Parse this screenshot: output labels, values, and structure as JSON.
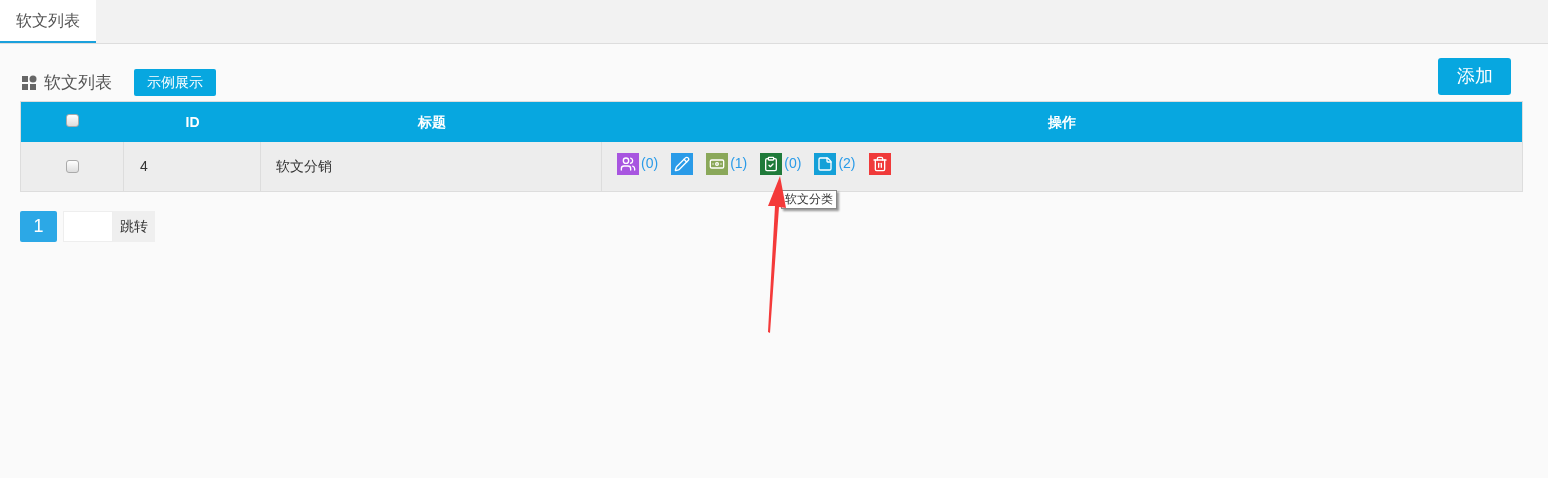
{
  "tabs": [
    {
      "label": "软文列表",
      "selected": true
    }
  ],
  "panel": {
    "title": "软文列表",
    "demo_button": "示例展示",
    "add_button": "添加"
  },
  "table": {
    "columns": [
      "ID",
      "标题",
      "操作"
    ],
    "header_checked": false,
    "rows": [
      {
        "checked": false,
        "id": "4",
        "title": "软文分销",
        "actions": [
          {
            "kind": "users",
            "color": "#a855e0",
            "count": "(0)"
          },
          {
            "kind": "edit",
            "color": "#2a9be8"
          },
          {
            "kind": "money",
            "color": "#8aa85a",
            "count": "(1)"
          },
          {
            "kind": "clipboard",
            "color": "#1f7a3a",
            "count": "(0)"
          },
          {
            "kind": "note",
            "color": "#14a0d8",
            "count": "(2)"
          },
          {
            "kind": "delete",
            "color": "#f03a3a"
          }
        ]
      }
    ]
  },
  "tooltip": "软文分类",
  "pagination": {
    "pages": [
      {
        "label": "1",
        "selected": true
      }
    ],
    "jump_button": "跳转"
  }
}
